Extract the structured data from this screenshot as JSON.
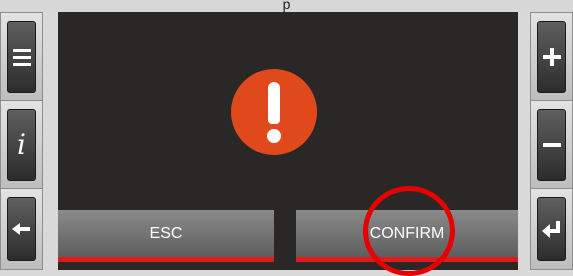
{
  "window": {
    "caption": "p"
  },
  "left_buttons": [
    {
      "name": "menu",
      "glyph": ""
    },
    {
      "name": "info",
      "glyph": "i"
    },
    {
      "name": "back",
      "glyph": "←"
    }
  ],
  "right_buttons": [
    {
      "name": "plus",
      "glyph": "+"
    },
    {
      "name": "minus",
      "glyph": "−"
    },
    {
      "name": "enter",
      "glyph": "↵"
    }
  ],
  "screen": {
    "alert_icon": "exclamation-icon",
    "softkeys": {
      "esc_label": "ESC",
      "confirm_label": "CONFIRM"
    }
  },
  "colors": {
    "screen_bg": "#2a2727",
    "alert": "#e0491b",
    "softkey_accent": "#e11b1b",
    "highlight_ring": "#e60000"
  }
}
